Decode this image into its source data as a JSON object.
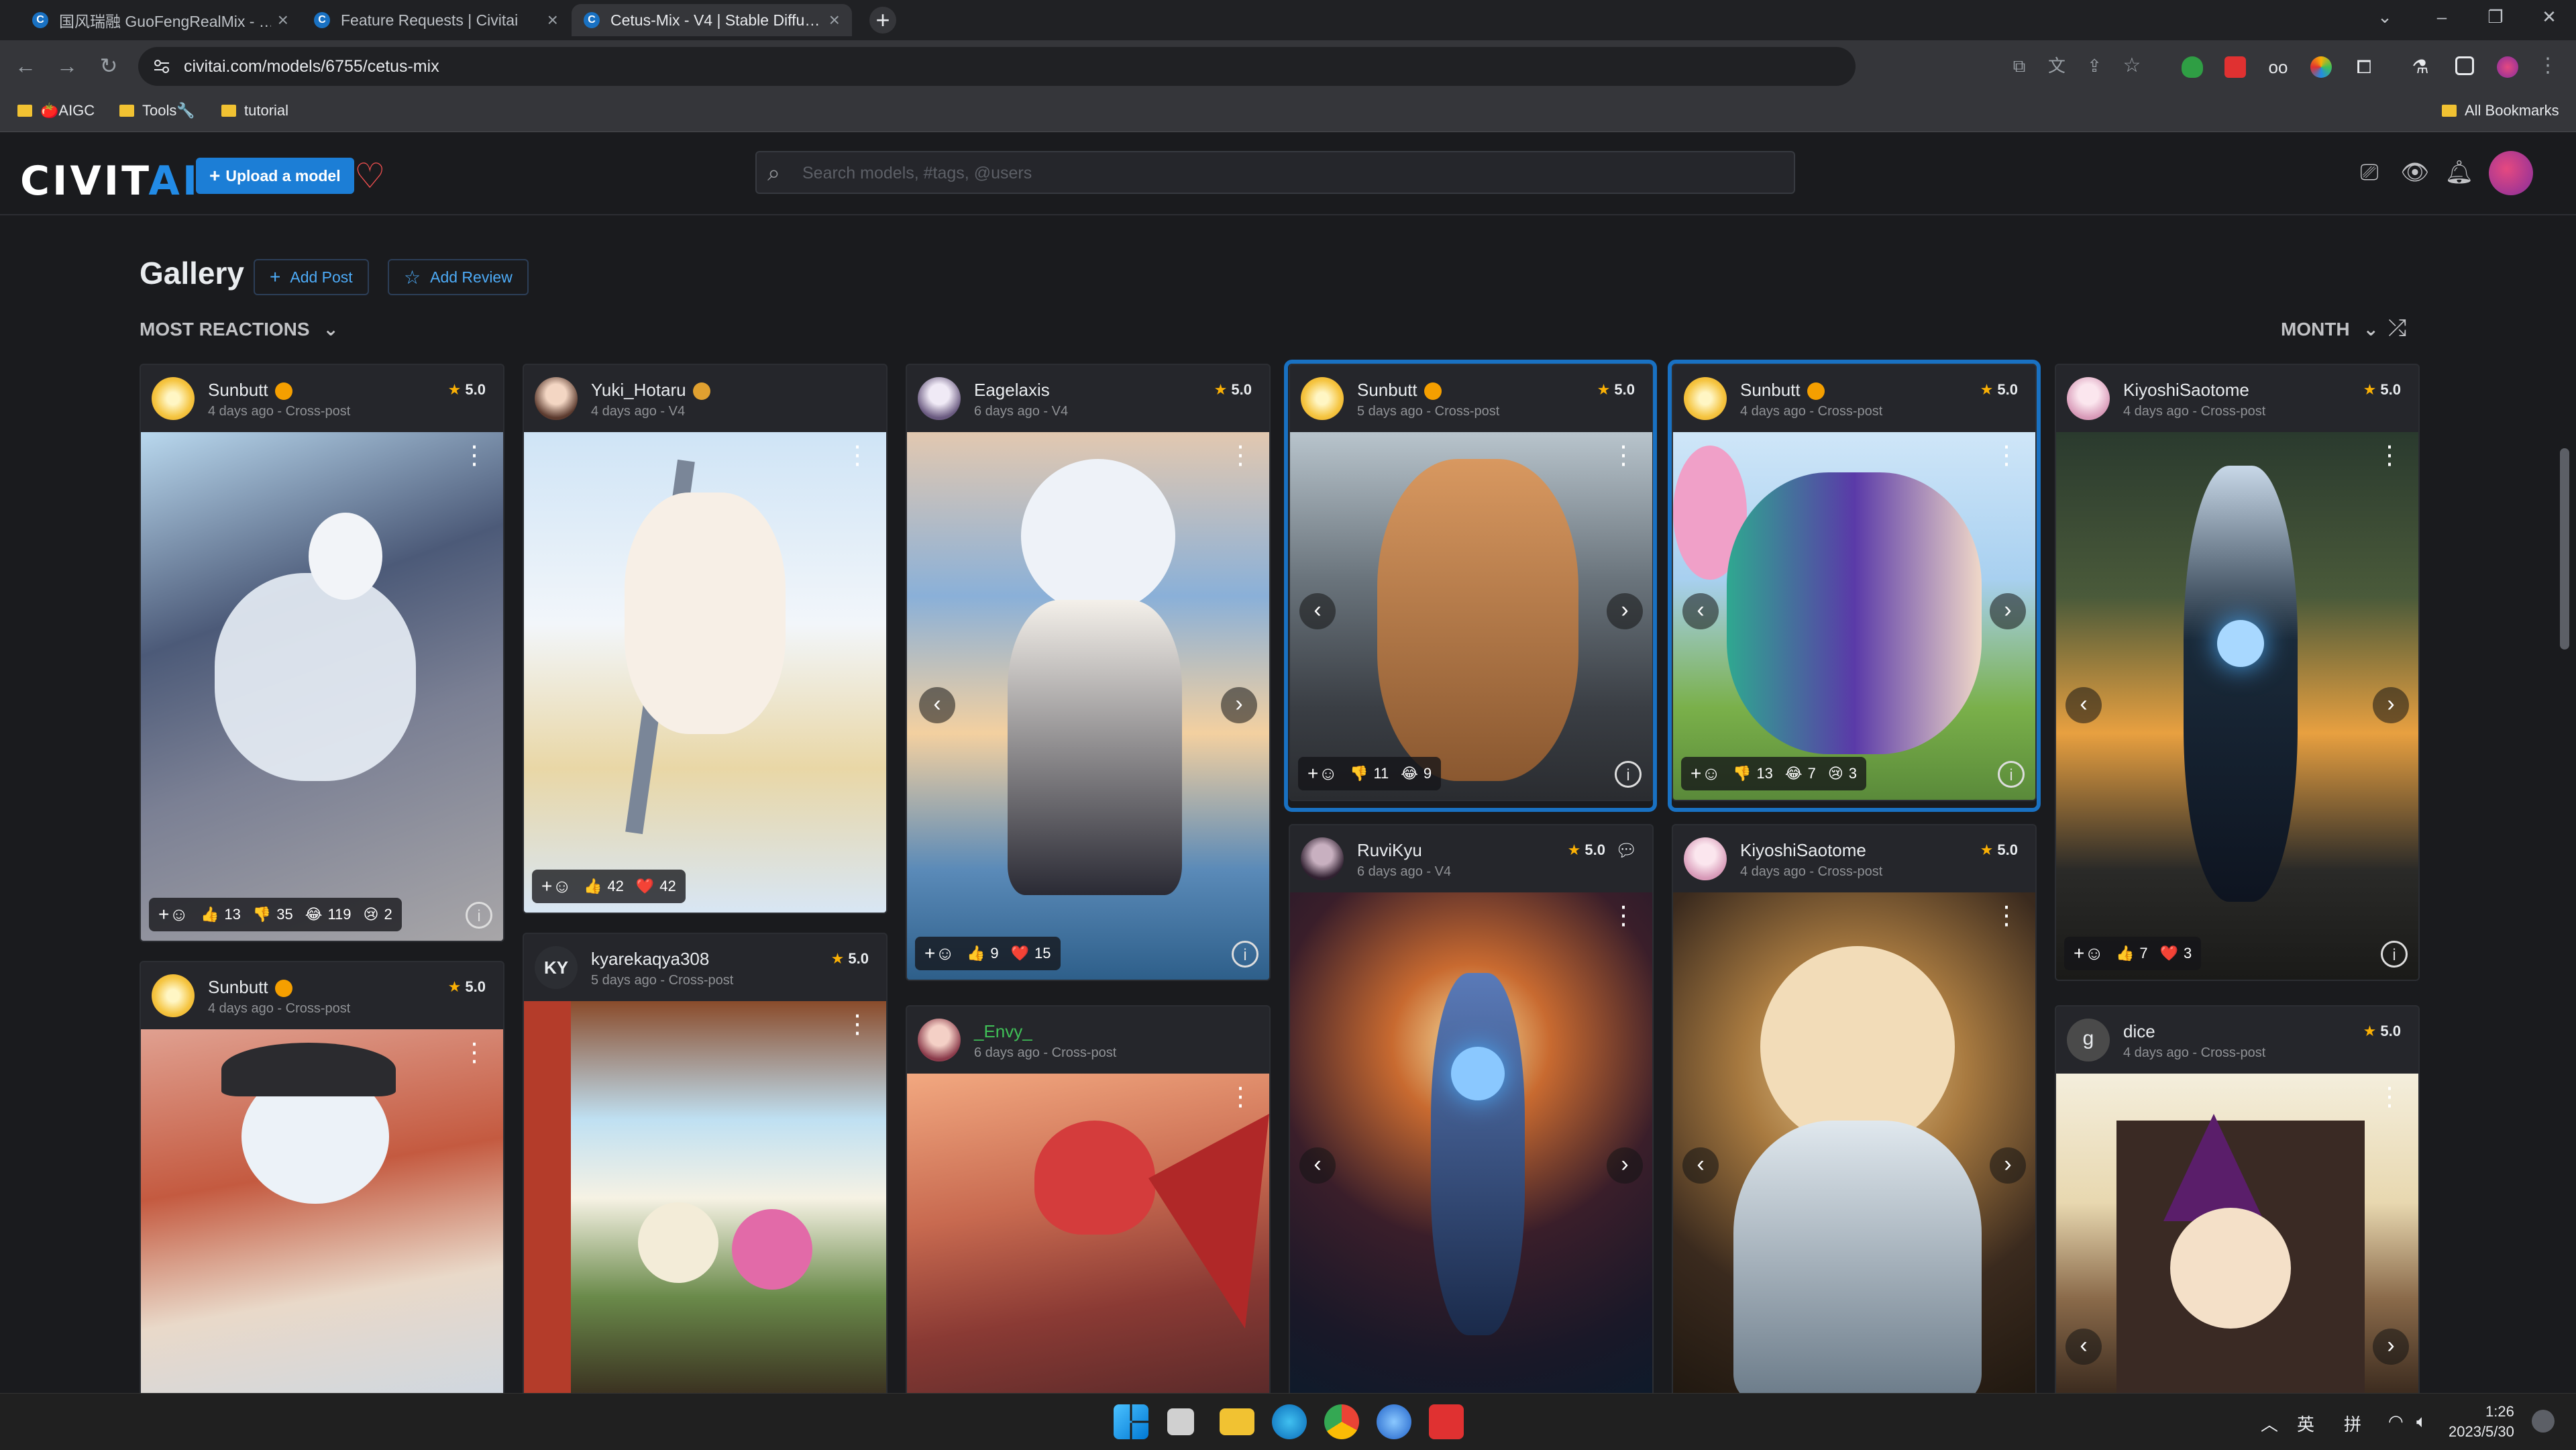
{
  "browser": {
    "tabs": [
      {
        "title": "国风瑞融 GuoFengRealMix - …"
      },
      {
        "title": "Feature Requests | Civitai"
      },
      {
        "title": "Cetus-Mix - V4 | Stable Diffu…"
      }
    ],
    "url": "civitai.com/models/6755/cetus-mix",
    "bookmarks": [
      {
        "label": "🍅AIGC"
      },
      {
        "label": "Tools🔧"
      },
      {
        "label": "tutorial"
      }
    ],
    "all_bookmarks": "All Bookmarks"
  },
  "site": {
    "logo_main": "CIVIT",
    "logo_accent": "AI",
    "upload_label": "Upload a model",
    "search_placeholder": "Search models, #tags, @users"
  },
  "gallery": {
    "title": "Gallery",
    "add_post": "Add Post",
    "add_review": "Add Review",
    "sort": "MOST REACTIONS",
    "period": "MONTH"
  },
  "cards": [
    {
      "user": "Sunbutt",
      "meta": "4 days ago - Cross-post",
      "rating": "5.0",
      "avatar": "#f5c542",
      "reactions": [
        {
          "e": "👍",
          "n": "13"
        },
        {
          "e": "👎",
          "n": "35"
        },
        {
          "e": "😂",
          "n": "119"
        },
        {
          "e": "😢",
          "n": "2"
        }
      ]
    },
    {
      "user": "Sunbutt",
      "meta": "4 days ago - Cross-post",
      "rating": "5.0",
      "avatar": "#f5c542"
    },
    {
      "user": "Yuki_Hotaru",
      "meta": "4 days ago - V4",
      "rating": "5.0",
      "avatar": "#b88f7a",
      "reactions": [
        {
          "e": "👍",
          "n": "42"
        },
        {
          "e": "❤️",
          "n": "42"
        }
      ]
    },
    {
      "user": "kyarekaqya308",
      "meta": "5 days ago - Cross-post",
      "rating": "5.0",
      "avatar": "#2c2e33",
      "initials": "KY"
    },
    {
      "user": "Eagelaxis",
      "meta": "6 days ago - V4",
      "rating": "5.0",
      "avatar": "#d9d0e8",
      "reactions": [
        {
          "e": "👍",
          "n": "9"
        },
        {
          "e": "❤️",
          "n": "15"
        }
      ]
    },
    {
      "user": "_Envy_",
      "meta": "6 days ago - Cross-post",
      "rating": "",
      "avatar": "#a05060"
    },
    {
      "user": "Sunbutt",
      "meta": "5 days ago - Cross-post",
      "rating": "5.0",
      "avatar": "#f5c542",
      "reactions": [
        {
          "e": "👎",
          "n": "11"
        },
        {
          "e": "😂",
          "n": "9"
        }
      ]
    },
    {
      "user": "RuviKyu",
      "meta": "6 days ago - V4",
      "rating": "5.0",
      "avatar": "#402030"
    },
    {
      "user": "Sunbutt",
      "meta": "4 days ago - Cross-post",
      "rating": "5.0",
      "avatar": "#f5c542",
      "reactions": [
        {
          "e": "👎",
          "n": "13"
        },
        {
          "e": "😂",
          "n": "7"
        },
        {
          "e": "😢",
          "n": "3"
        }
      ]
    },
    {
      "user": "KiyoshiSaotome",
      "meta": "4 days ago - Cross-post",
      "rating": "5.0",
      "avatar": "#f0c8d8"
    },
    {
      "user": "KiyoshiSaotome",
      "meta": "4 days ago - Cross-post",
      "rating": "5.0",
      "avatar": "#f0c8d8",
      "reactions": [
        {
          "e": "👍",
          "n": "7"
        },
        {
          "e": "❤️",
          "n": "3"
        }
      ]
    },
    {
      "user": "dice",
      "meta": "4 days ago - Cross-post",
      "rating": "5.0",
      "avatar": "#4a4a4a",
      "initials": "g"
    }
  ],
  "taskbar": {
    "time": "1:26",
    "date": "2023/5/30",
    "ime1": "英",
    "ime2": "拼"
  },
  "colors": {
    "accent": "#1c7ed6",
    "background": "#1a1b1e",
    "card": "#25262b",
    "highlight": "#1971c2",
    "star": "#fab005"
  }
}
